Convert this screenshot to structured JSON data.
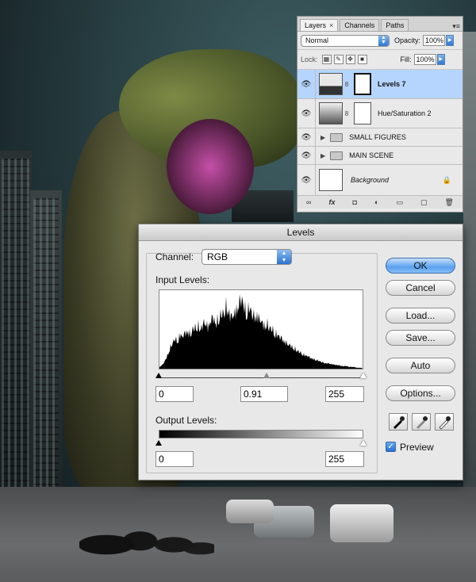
{
  "layers_panel": {
    "tabs": [
      {
        "label": "Layers"
      },
      {
        "label": "Channels"
      },
      {
        "label": "Paths"
      }
    ],
    "close_glyph": "×",
    "menu_glyph": "▾≡",
    "blend_mode": "Normal",
    "opacity_label": "Opacity:",
    "opacity_value": "100%",
    "lock_label": "Lock:",
    "fill_label": "Fill:",
    "fill_value": "100%",
    "layers": [
      {
        "name": "Levels 7",
        "type": "adjustment",
        "selected": true
      },
      {
        "name": "Hue/Saturation 2",
        "type": "adjustment",
        "selected": false
      },
      {
        "name": "SMALL FIGURES",
        "type": "group",
        "selected": false
      },
      {
        "name": "MAIN SCENE",
        "type": "group",
        "selected": false
      },
      {
        "name": "Background",
        "type": "background",
        "selected": false
      }
    ],
    "footer_icons": [
      "link-icon",
      "fx-icon",
      "mask-icon",
      "adjustment-icon",
      "folder-icon",
      "new-layer-icon",
      "trash-icon"
    ],
    "footer_glyphs": [
      "∞",
      "fx",
      "◘",
      "◐",
      "▭",
      "▢",
      "🗑"
    ]
  },
  "levels_dialog": {
    "title": "Levels",
    "channel_label": "Channel:",
    "channel_value": "RGB",
    "input_levels_label": "Input Levels:",
    "input_black": "0",
    "input_gamma": "0.91",
    "input_white": "255",
    "output_levels_label": "Output Levels:",
    "output_black": "0",
    "output_white": "255",
    "buttons": {
      "ok": "OK",
      "cancel": "Cancel",
      "load": "Load...",
      "save": "Save...",
      "auto": "Auto",
      "options": "Options..."
    },
    "preview_label": "Preview",
    "preview_checked": true
  },
  "histogram_profile": [
    2,
    4,
    8,
    14,
    22,
    28,
    34,
    30,
    38,
    36,
    40,
    42,
    38,
    44,
    46,
    48,
    44,
    50,
    52,
    46,
    54,
    58,
    50,
    56,
    60,
    62,
    70,
    64,
    58,
    60,
    66,
    72,
    80,
    70,
    62,
    68,
    64,
    58,
    60,
    56,
    52,
    48,
    50,
    46,
    44,
    40,
    38,
    36,
    33,
    30,
    28,
    26,
    24,
    22,
    20,
    18,
    16,
    15,
    14,
    12,
    11,
    10,
    9,
    8,
    7,
    6,
    6,
    5,
    5,
    4,
    4,
    3,
    3,
    3,
    2,
    2,
    2,
    1,
    1,
    1
  ]
}
